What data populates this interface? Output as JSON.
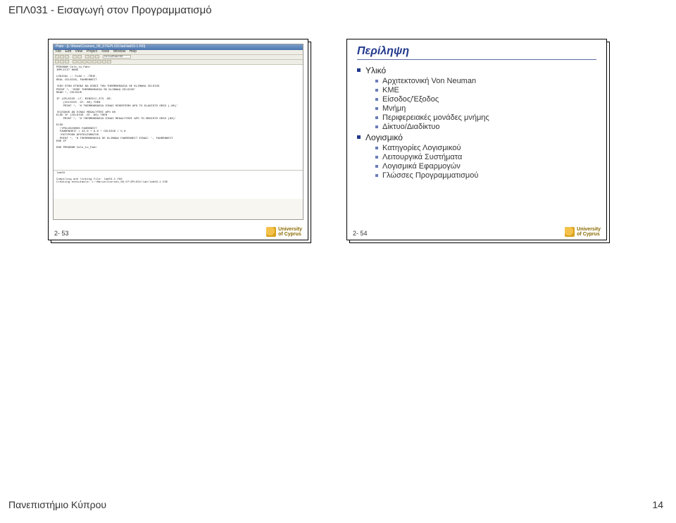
{
  "page": {
    "header": "ΕΠΛ031 - Εισαγωγή στον Προγραμματισμό",
    "footer_left": "Πανεπιστήμιο Κύπρου",
    "footer_right": "14",
    "university_line1": "University",
    "university_line2": "of Cyprus"
  },
  "slide_left": {
    "number": "2- 53",
    "editor": {
      "title": "Plato - [L:\\Maria\\Courses_08_07\\EPL031\\lab\\lab03-1.f90]",
      "menu": [
        "File",
        "Edit",
        "View",
        "Project",
        "Tools",
        "Window",
        "Help"
      ],
      "toolbar_combo": "Cels2Fahr03",
      "code": "PROGRAM Cels_to_Fahr\nIMPLICIT NONE\n\nLOGICAL :: FLAG = .TRUE.\nREAL CELSIUS, FAHRENHEIT\n\n!EDO STHN OTHONI NA DOSEI THN THERMOKRASIA SE KLIMAKA CELSIUS\nPRINT *, 'DOSE THERMOKRASIA SE KLIMAKA CELSIUS'\nREAD *, CELSIUS\n\nIF (CELSIUS .LT. MINCELC-273 .OR.\n    (CELSIUS .GT. 80) THEN\n    PRINT *, 'H THERMOKRASIA EINAI MIKROTERH APO TO ELAXISTO ORIO (-80)'\n\n!ELEGXOS AN EINAI MEGALYTERI APO 80\nELSE IF (CELSIUS .GT. 80) THEN\n    PRINT *, 'H THERMOKRASIA EINAI MEGALYTERI APO TO MEGISTO ORIO (80)'\n\nELSE\n  !YPOLOGISMOS FAHRENEIT\n  FAHRENHEIT = 32.0 + 9.0 * CELSIUS / 5.0\n  !EKTYPOSH APOTELESMATOS\n  PRINT *, 'H THERMOKRASIA SE KLIMAKA FAHRENHEIT EINAI: ', FAHRENHEIT\nEND IF\n\nEND PROGRAM Cels_to_Fahr",
      "output": "lab03\n\nCompiling and linking file: lab03-1.f90\nCreating executable: L:\\Maria\\Courses_08_07\\EPL031\\lab\\lab03-1.EXE"
    }
  },
  "slide_right": {
    "number": "2- 54",
    "title": "Περίληψη",
    "items": [
      {
        "label": "Υλικό",
        "children": [
          "Αρχιτεκτονική Von Neuman",
          "ΚΜΕ",
          "Είσοδος/Έξοδος",
          "Μνήμη",
          "Περιφερειακές μονάδες μνήμης",
          "Δίκτυο/Διαδίκτυο"
        ]
      },
      {
        "label": "Λογισμικό",
        "children": [
          "Κατηγορίες Λογισμικού",
          "Λειτουργικά Συστήματα",
          "Λογισμικά Εφαρμογών",
          "Γλώσσες Προγραμματισμού"
        ]
      }
    ]
  }
}
